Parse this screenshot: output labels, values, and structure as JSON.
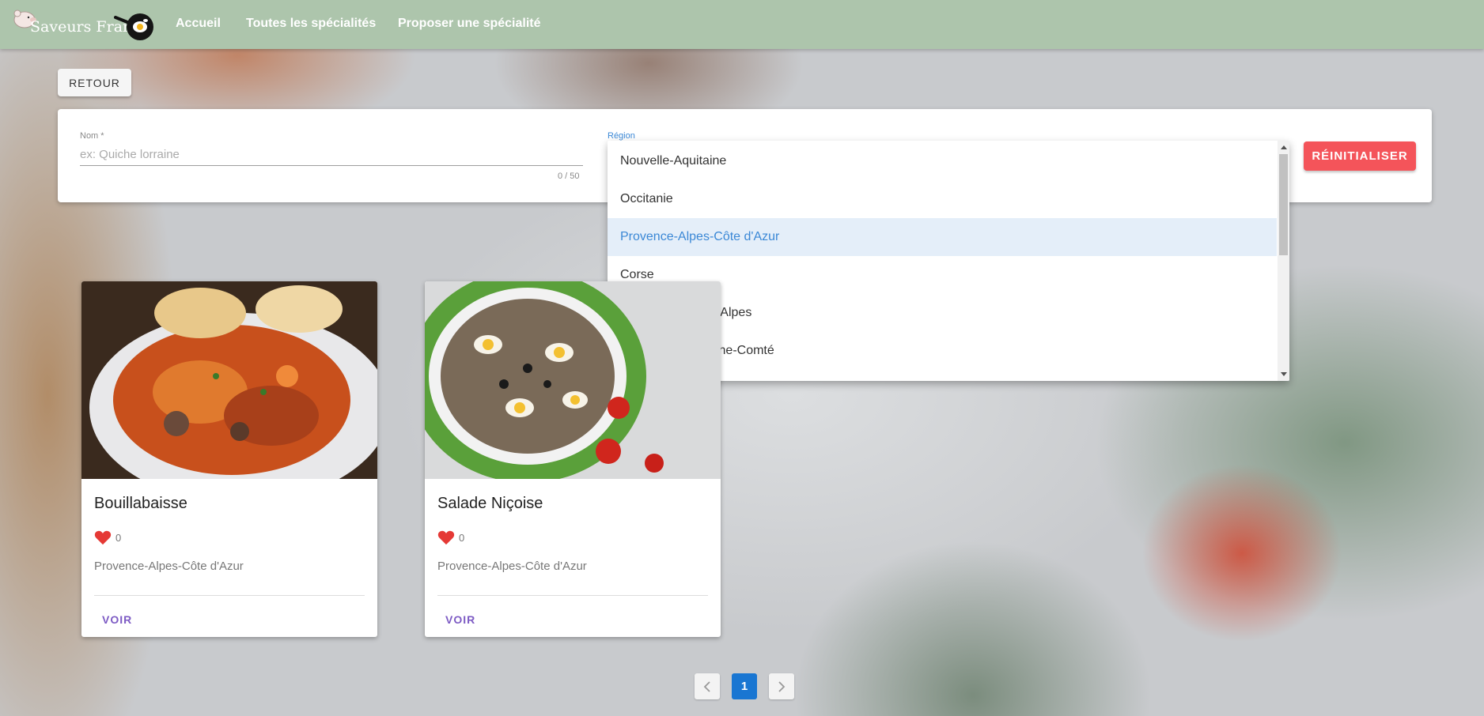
{
  "header": {
    "logo_text": "Saveurs France",
    "nav": [
      {
        "label": "Accueil"
      },
      {
        "label": "Toutes les spécialités"
      },
      {
        "label": "Proposer une spécialité"
      }
    ]
  },
  "back_button": {
    "label": "RETOUR"
  },
  "filters": {
    "name_label": "Nom *",
    "name_placeholder": "ex: Quiche lorraine",
    "name_value": "",
    "char_count": "0 / 50",
    "region_label": "Région",
    "reset_label": "RÉINITIALISER"
  },
  "region_dropdown": {
    "selected": "Provence-Alpes-Côte d'Azur",
    "options": [
      {
        "label": "Nouvelle-Aquitaine"
      },
      {
        "label": "Occitanie"
      },
      {
        "label": "Provence-Alpes-Côte d'Azur"
      },
      {
        "label": "Corse"
      },
      {
        "label": "Auvergne-Rhône-Alpes"
      },
      {
        "label": "Bourgogne-Franche-Comté"
      }
    ]
  },
  "cards": [
    {
      "title": "Bouillabaisse",
      "likes": "0",
      "region": "Provence-Alpes-Côte d'Azur",
      "action": "VOIR"
    },
    {
      "title": "Salade Niçoise",
      "likes": "0",
      "region": "Provence-Alpes-Côte d'Azur",
      "action": "VOIR"
    }
  ],
  "pagination": {
    "prev_icon": "chevron-left-icon",
    "current": "1",
    "next_icon": "chevron-right-icon"
  },
  "colors": {
    "header": "#adc5ac",
    "reset": "#f4545a",
    "selected_option": "#3b88d6",
    "page_active": "#1976d2",
    "voir": "#7d5bc4",
    "heart": "#e53935"
  }
}
